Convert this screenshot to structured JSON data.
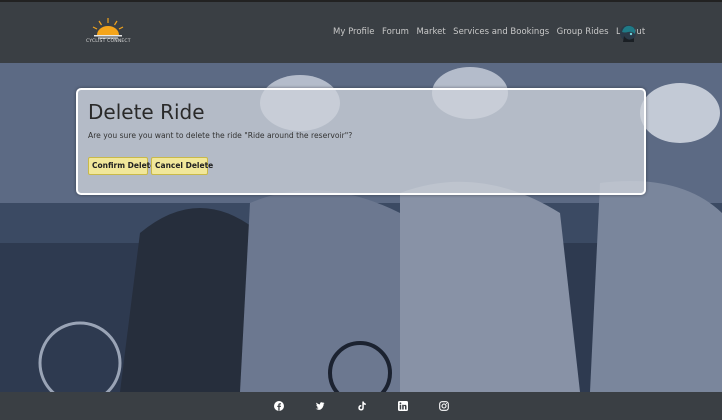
{
  "brand": {
    "logo_text": "CYCLIST CONNECT"
  },
  "nav": {
    "items": [
      {
        "label": "My Profile"
      },
      {
        "label": "Forum"
      },
      {
        "label": "Market"
      },
      {
        "label": "Services and Bookings"
      },
      {
        "label": "Group Rides"
      },
      {
        "label": "Logout"
      }
    ]
  },
  "dialog": {
    "title": "Delete Ride",
    "message": "Are you sure you want to delete the ride \"Ride around the reservoir\"?",
    "confirm_label": "Confirm Delete",
    "cancel_label": "Cancel Delete"
  },
  "footer": {
    "icons": [
      "facebook-icon",
      "twitter-icon",
      "tiktok-icon",
      "linkedin-icon",
      "instagram-icon"
    ]
  },
  "colors": {
    "navbar_bg": "#3a3f44",
    "button_bg": "#f1e79a",
    "hero_tint": "#3b4a63"
  }
}
